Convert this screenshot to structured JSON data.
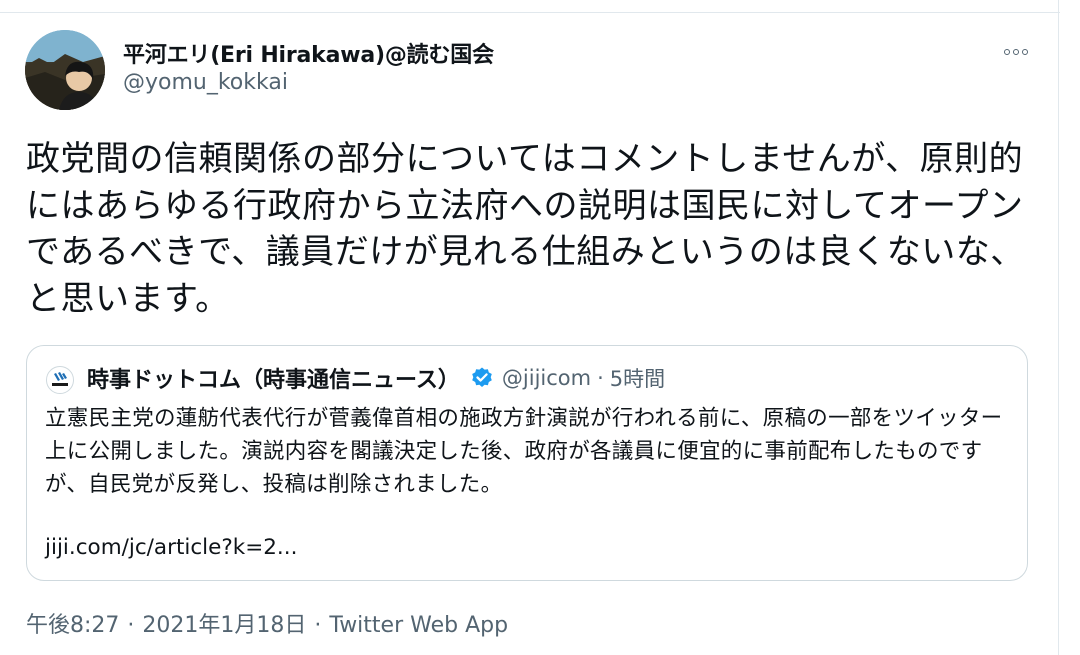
{
  "author": {
    "display_name": "平河エリ(Eri Hirakawa)@読む国会",
    "handle": "@yomu_kokkai"
  },
  "tweet": {
    "text": "政党間の信頼関係の部分についてはコメントしませんが、原則的にはあらゆる行政府から立法府への説明は国民に対してオープンであるべきで、議員だけが見れる仕組みというのは良くないな、と思います。"
  },
  "quoted_tweet": {
    "logo_text": "JIJI.COM",
    "display_name": "時事ドットコム（時事通信ニュース）",
    "verified": true,
    "handle": "@jijicom",
    "separator": "·",
    "time": "5時間",
    "text": "立憲民主党の蓮舫代表代行が菅義偉首相の施政方針演説が行われる前に、原稿の一部をツイッター上に公開しました。演説内容を閣議決定した後、政府が各議員に便宜的に事前配布したものですが、自民党が反発し、投稿は削除されました。",
    "link": "jiji.com/jc/article?k=2..."
  },
  "meta": {
    "time": "午後8:27",
    "separator": "·",
    "date": "2021年1月18日",
    "source": "Twitter Web App"
  },
  "icons": {
    "more": "more-horizontal-icon",
    "verified": "verified-badge-icon"
  },
  "colors": {
    "text": "#0f1419",
    "secondary": "#536471",
    "verified": "#1d9bf0",
    "border": "#cfd9de"
  }
}
